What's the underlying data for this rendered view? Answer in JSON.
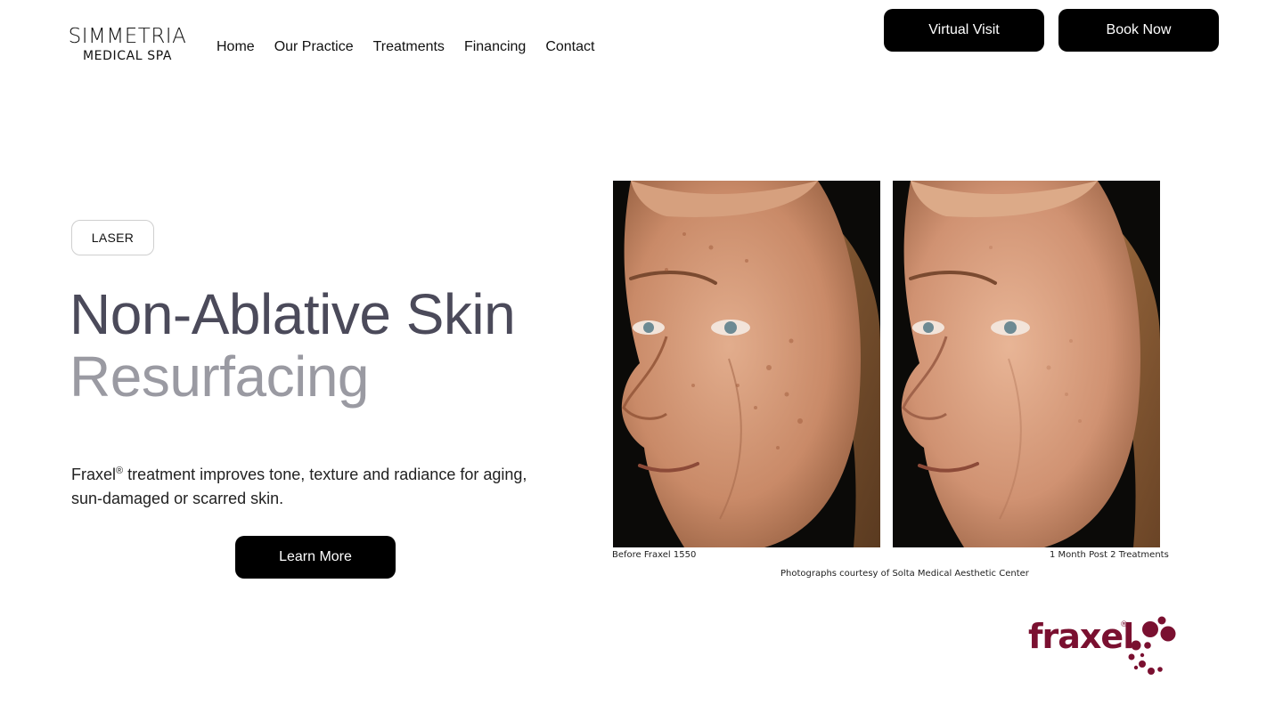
{
  "header": {
    "logo_top": "SIMMETRIA",
    "logo_bottom": "MEDICAL SPA",
    "nav": [
      "Home",
      "Our Practice",
      "Treatments",
      "Financing",
      "Contact"
    ],
    "virtual_visit_label": "Virtual Visit",
    "book_now_label": "Book Now"
  },
  "hero": {
    "tag": "LASER",
    "title_line1": "Non-Ablative Skin",
    "title_line2": "Resurfacing",
    "description_brand": "Fraxel",
    "description_mark": "®",
    "description_rest": " treatment improves tone, texture and radiance for aging, sun-damaged or scarred skin.",
    "learn_more_label": "Learn More"
  },
  "image": {
    "caption_before": "Before Fraxel 1550",
    "caption_after": "1 Month Post 2 Treatments",
    "credit": "Photographs courtesy of Solta Medical Aesthetic Center"
  },
  "brand_logo": {
    "text": "fraxel",
    "mark": "®",
    "color": "#7a1030"
  },
  "colors": {
    "title_dark": "#4b4a5a",
    "title_light": "#9a9aa2",
    "button_bg": "#000000"
  }
}
